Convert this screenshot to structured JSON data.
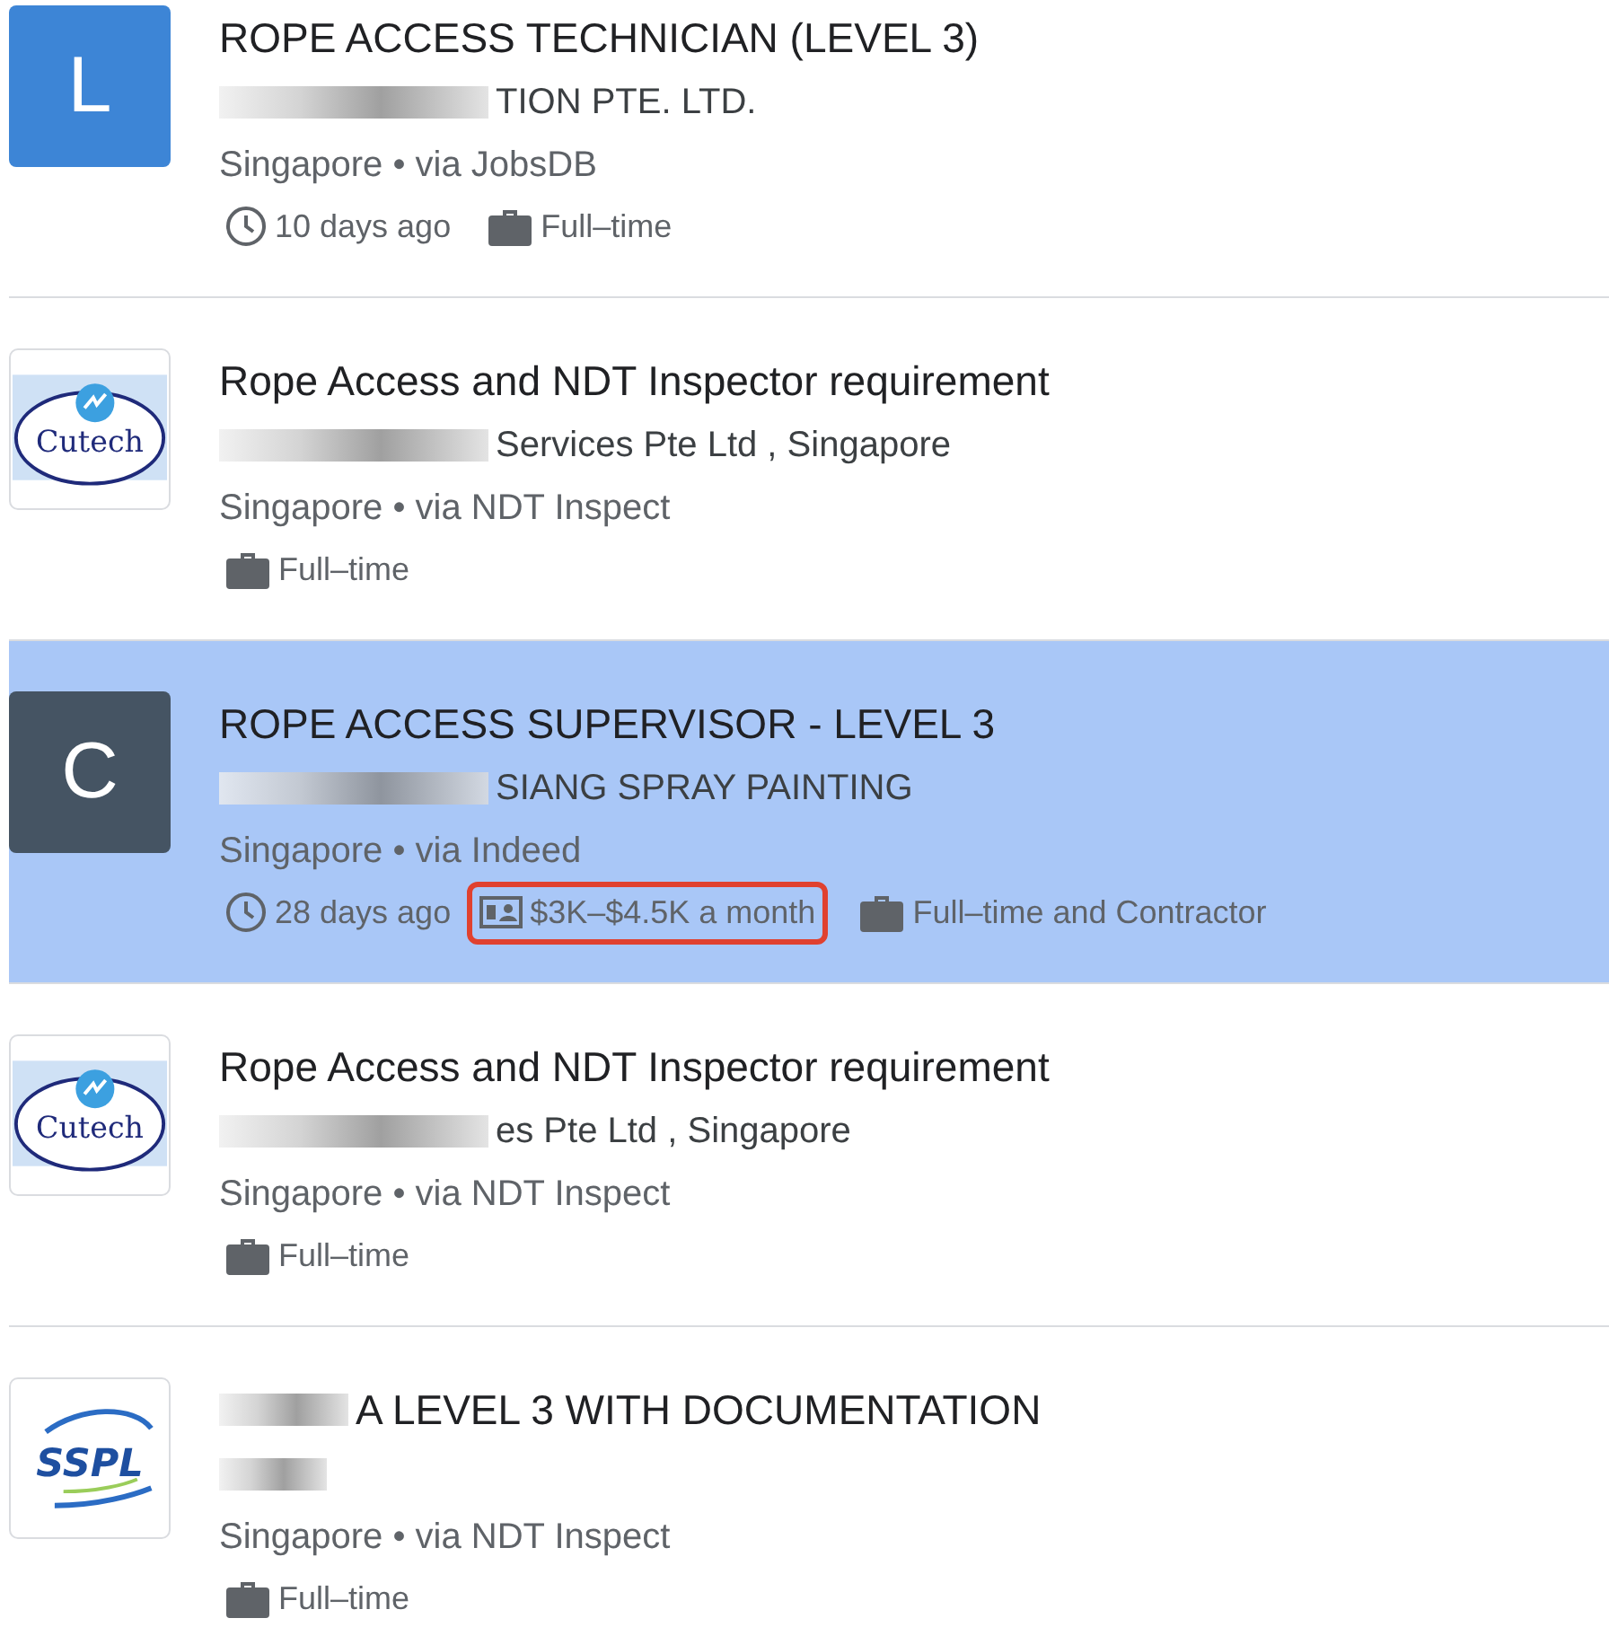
{
  "jobs": [
    {
      "selected": false,
      "logo": {
        "kind": "letter",
        "text": "L",
        "color": "#3d85d6"
      },
      "title": "ROPE ACCESS TECHNICIAN (LEVEL 3)",
      "title_redacted": false,
      "company": "TION PTE. LTD.",
      "company_redacted": true,
      "location": "Singapore • via JobsDB",
      "meta": [
        {
          "kind": "posted",
          "text": "10 days ago",
          "highlighted": false
        },
        {
          "kind": "type",
          "text": "Full–time",
          "highlighted": false
        }
      ]
    },
    {
      "selected": false,
      "logo": {
        "kind": "oval",
        "text": "Cutech"
      },
      "title": "Rope Access and NDT Inspector requirement",
      "title_redacted": false,
      "company": "Services Pte Ltd , Singapore",
      "company_redacted": true,
      "location": "Singapore • via NDT Inspect",
      "meta": [
        {
          "kind": "type",
          "text": "Full–time",
          "highlighted": false
        }
      ]
    },
    {
      "selected": true,
      "logo": {
        "kind": "letter",
        "text": "C",
        "color": "#455463"
      },
      "title": "ROPE ACCESS SUPERVISOR - LEVEL 3",
      "title_redacted": false,
      "company": "SIANG SPRAY PAINTING",
      "company_redacted": true,
      "location": "Singapore • via Indeed",
      "meta": [
        {
          "kind": "posted",
          "text": "28 days ago",
          "highlighted": false
        },
        {
          "kind": "salary",
          "text": "$3K–$4.5K a month",
          "highlighted": true
        },
        {
          "kind": "type",
          "text": "Full–time and Contractor",
          "highlighted": false
        }
      ]
    },
    {
      "selected": false,
      "logo": {
        "kind": "oval",
        "text": "Cutech"
      },
      "title": "Rope Access and NDT Inspector requirement",
      "title_redacted": false,
      "company": "es Pte Ltd , Singapore",
      "company_redacted": true,
      "location": "Singapore • via NDT Inspect",
      "meta": [
        {
          "kind": "type",
          "text": "Full–time",
          "highlighted": false
        }
      ]
    },
    {
      "selected": false,
      "logo": {
        "kind": "swoosh",
        "text": "SSPL"
      },
      "title": "A LEVEL 3 WITH DOCUMENTATION",
      "title_redacted": true,
      "company_redacted": true,
      "location": "Singapore • via NDT Inspect",
      "meta": [
        {
          "kind": "type",
          "text": "Full–time",
          "highlighted": false
        }
      ]
    }
  ]
}
